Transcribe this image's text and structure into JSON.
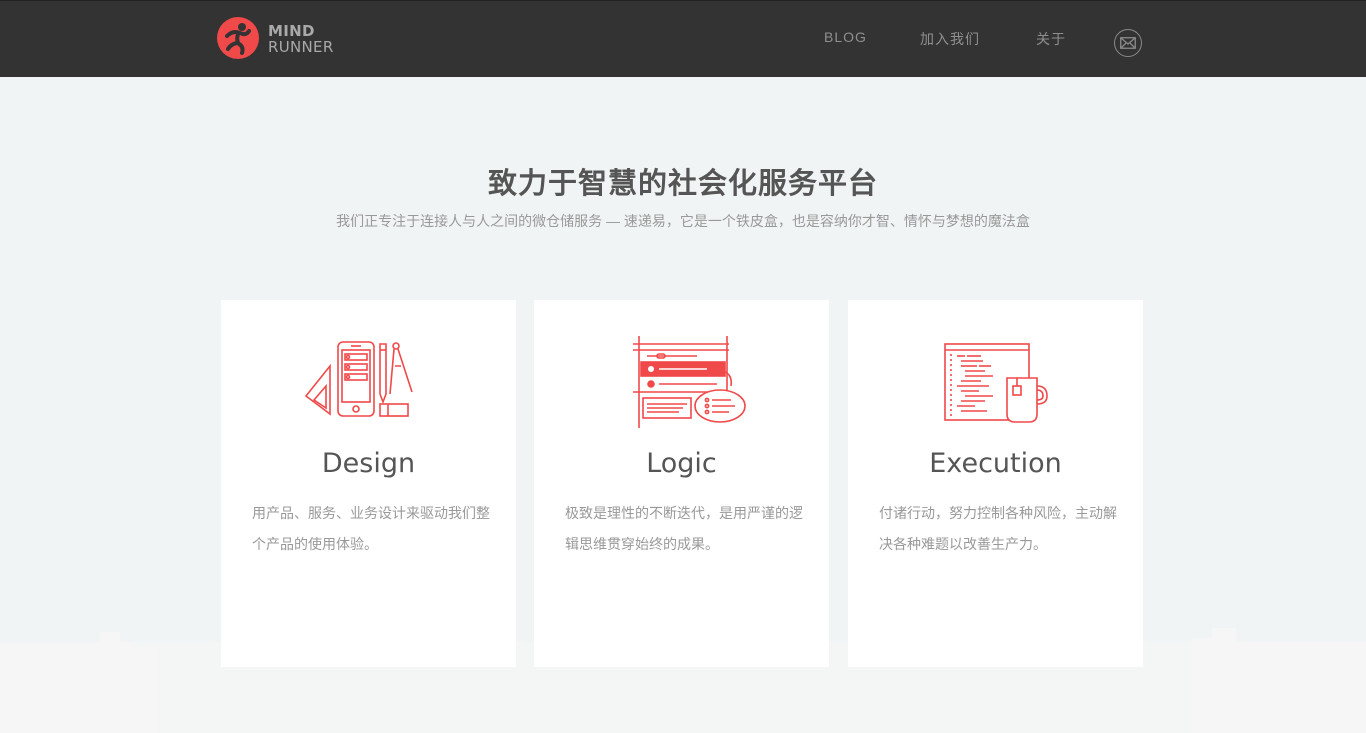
{
  "brand": {
    "line1": "MIND",
    "line2": "RUNNER",
    "accent": "#f0494a"
  },
  "nav": {
    "blog": "BLOG",
    "join": "加入我们",
    "about": "关于",
    "mail_icon": "envelope-icon"
  },
  "hero": {
    "title": "致力于智慧的社会化服务平台",
    "subtitle": "我们正专注于连接人与人之间的微仓储服务 — 速递易，它是一个铁皮盒，也是容纳你才智、情怀与梦想的魔法盒"
  },
  "cards": [
    {
      "icon": "design-tools-icon",
      "title": "Design",
      "text": "用产品、服务、业务设计来驱动我们整个产品的使用体验。"
    },
    {
      "icon": "logic-flow-icon",
      "title": "Logic",
      "text": "极致是理性的不断迭代，是用严谨的逻辑思维贯穿始终的成果。"
    },
    {
      "icon": "code-and-tea-icon",
      "title": "Execution",
      "text": "付诸行动，努力控制各种风险，主动解决各种难题以改善生产力。"
    }
  ],
  "colors": {
    "topbar": "#333333",
    "background": "#f1f4f5",
    "icon_red": "#f0494a"
  }
}
